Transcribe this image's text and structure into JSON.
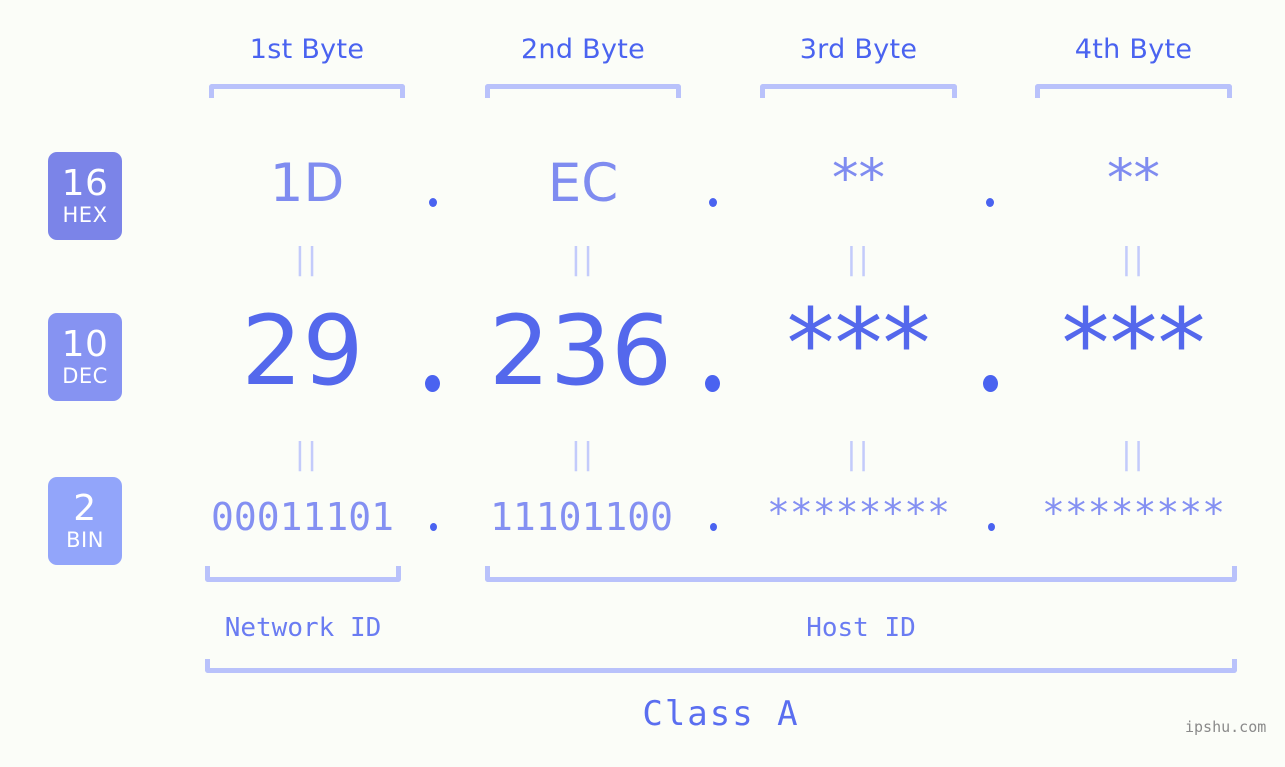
{
  "background_color": "#fbfdf8",
  "accent_colors": {
    "strong_blue": "#4a63f0",
    "mid_blue": "#7f8cf0",
    "light_blue": "#b9c2fb",
    "pale_blue": "#c3cbfb"
  },
  "byte_headers": [
    {
      "label": "1st Byte"
    },
    {
      "label": "2nd Byte"
    },
    {
      "label": "3rd Byte"
    },
    {
      "label": "4th Byte"
    }
  ],
  "rows": {
    "hex": {
      "badge": {
        "number": "16",
        "name": "HEX",
        "color": "#7b84e8"
      },
      "values": [
        "1D",
        "EC",
        "**",
        "**"
      ],
      "separator": "."
    },
    "dec": {
      "badge": {
        "number": "10",
        "name": "DEC",
        "color": "#8693f2"
      },
      "values": [
        "29",
        "236",
        "***",
        "***"
      ],
      "separator": "."
    },
    "bin": {
      "badge": {
        "number": "2",
        "name": "BIN",
        "color": "#92a5fa"
      },
      "values": [
        "00011101",
        "11101100",
        "********",
        "********"
      ],
      "separator": "."
    }
  },
  "equality_marks": [
    "||",
    "||",
    "||",
    "||",
    "||",
    "||",
    "||",
    "||"
  ],
  "id_labels": {
    "network": "Network ID",
    "host": "Host ID"
  },
  "class_label": "Class A",
  "watermark": "ipshu.com"
}
